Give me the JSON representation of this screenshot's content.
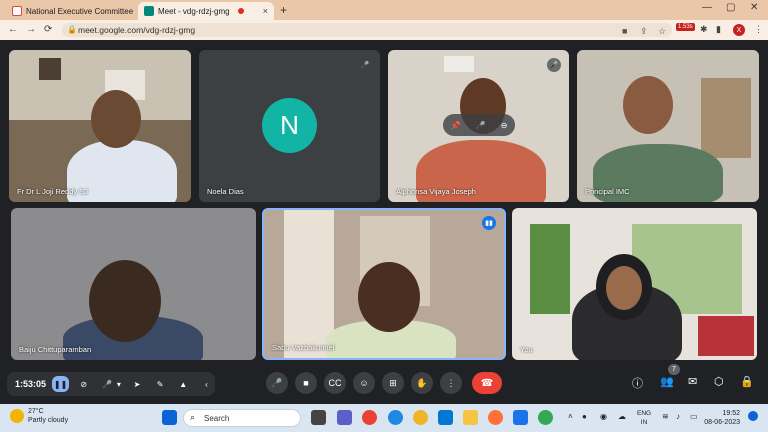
{
  "browser": {
    "tabs": [
      {
        "title": "National Executive Committee M",
        "close": "×"
      },
      {
        "title": "Meet - vdg-rdzj-gmg",
        "close": "×"
      }
    ],
    "new_tab": "+",
    "window_controls": {
      "minimize": "—",
      "maximize": "▢",
      "close": "✕"
    },
    "nav": {
      "back": "←",
      "forward": "→",
      "reload": "⟳"
    },
    "url": "meet.google.com/vdg-rdzj-gmg",
    "extension_badge": "1.53s",
    "profile_initial": "X"
  },
  "meet": {
    "participants": [
      {
        "name": "Fr Dr L Joji Reddy SJ"
      },
      {
        "name": "Noela Dias",
        "initial": "N",
        "muted": true
      },
      {
        "name": "Alphonsa Vijaya Joseph",
        "muted": true
      },
      {
        "name": "Principal IMC"
      },
      {
        "name": "Baiju Chittuparamban"
      },
      {
        "name": "Sabu Vazhakunnel",
        "speaking": true
      },
      {
        "name": "You"
      }
    ],
    "timer": "1:53:05",
    "participant_count": "7",
    "colors": {
      "accent": "#8ab4f8",
      "end_call": "#ea4335",
      "avatar_bg": "#12b5a5"
    }
  },
  "taskbar": {
    "weather_temp": "27°C",
    "weather_desc": "Partly cloudy",
    "search_label": "Search",
    "lang_top": "ENG",
    "lang_bottom": "IN",
    "time": "19:52",
    "date": "08-06-2023"
  }
}
